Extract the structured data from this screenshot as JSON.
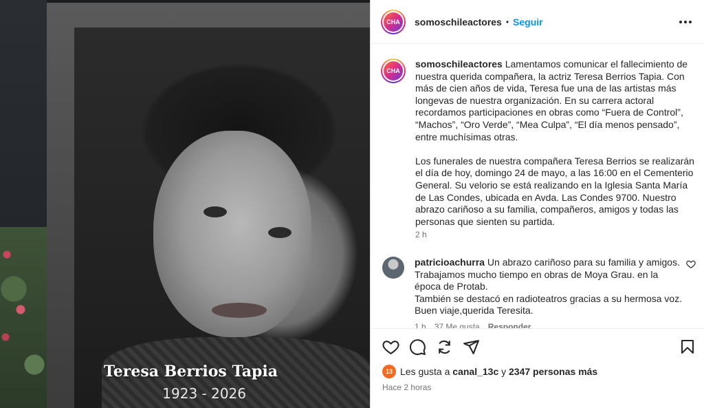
{
  "media": {
    "name": "Teresa Berrios Tapia",
    "years": "1923 - 2026"
  },
  "header": {
    "avatar_text": "CHA",
    "username": "somoschileactores",
    "separator": "•",
    "follow_label": "Seguir",
    "more_icon": "more-horizontal-icon"
  },
  "caption": {
    "username": "somoschileactores",
    "paragraph1": "Lamentamos comunicar el fallecimiento de nuestra querida compañera, la actriz Teresa Berrios Tapia. Con más de cien años de vida, Teresa fue una de las artistas más longevas de nuestra organización. En su carrera actoral recordamos participaciones en obras como “Fuera de Control”, “Machos”, “Oro Verde”, “Mea Culpa”, “El día menos pensado”, entre muchísimas otras.",
    "paragraph2": "Los funerales de nuestra compañera Teresa Berrios se realizarán el día de hoy, domingo 24 de mayo, a las 16:00 en el Cementerio General. Su velorio se está realizando en la Iglesia Santa María de Las Condes, ubicada en Avda. Las Condes 9700. Nuestro abrazo cariñoso a su familia, compañeros, amigos y todas las personas que sienten su partida.",
    "time": "2 h"
  },
  "comment": {
    "username": "patricioachurra",
    "line1": "Un abrazo cariñoso para su familia y amigos.",
    "line2": "Trabajamos mucho tiempo en obras de Moya Grau. en la época de Protab.",
    "line3": "También se destacó en radioteatros gracias a su hermosa voz.",
    "line4": "Buen viaje,querida Teresita.",
    "time": "1 h",
    "likes": "37 Me gusta",
    "reply": "Responder"
  },
  "actions": {
    "icons": [
      "heart-icon",
      "comment-icon",
      "share-icon",
      "send-icon",
      "bookmark-icon"
    ]
  },
  "likes": {
    "badge": "13",
    "prefix": "Les gusta a",
    "user": "canal_13c",
    "joiner": "y",
    "count_text": "2347 personas más"
  },
  "posted": "Hace 2 horas",
  "colors": {
    "link": "#0095f6",
    "text": "#262626",
    "muted": "#737373",
    "badge": "#f36b21"
  }
}
